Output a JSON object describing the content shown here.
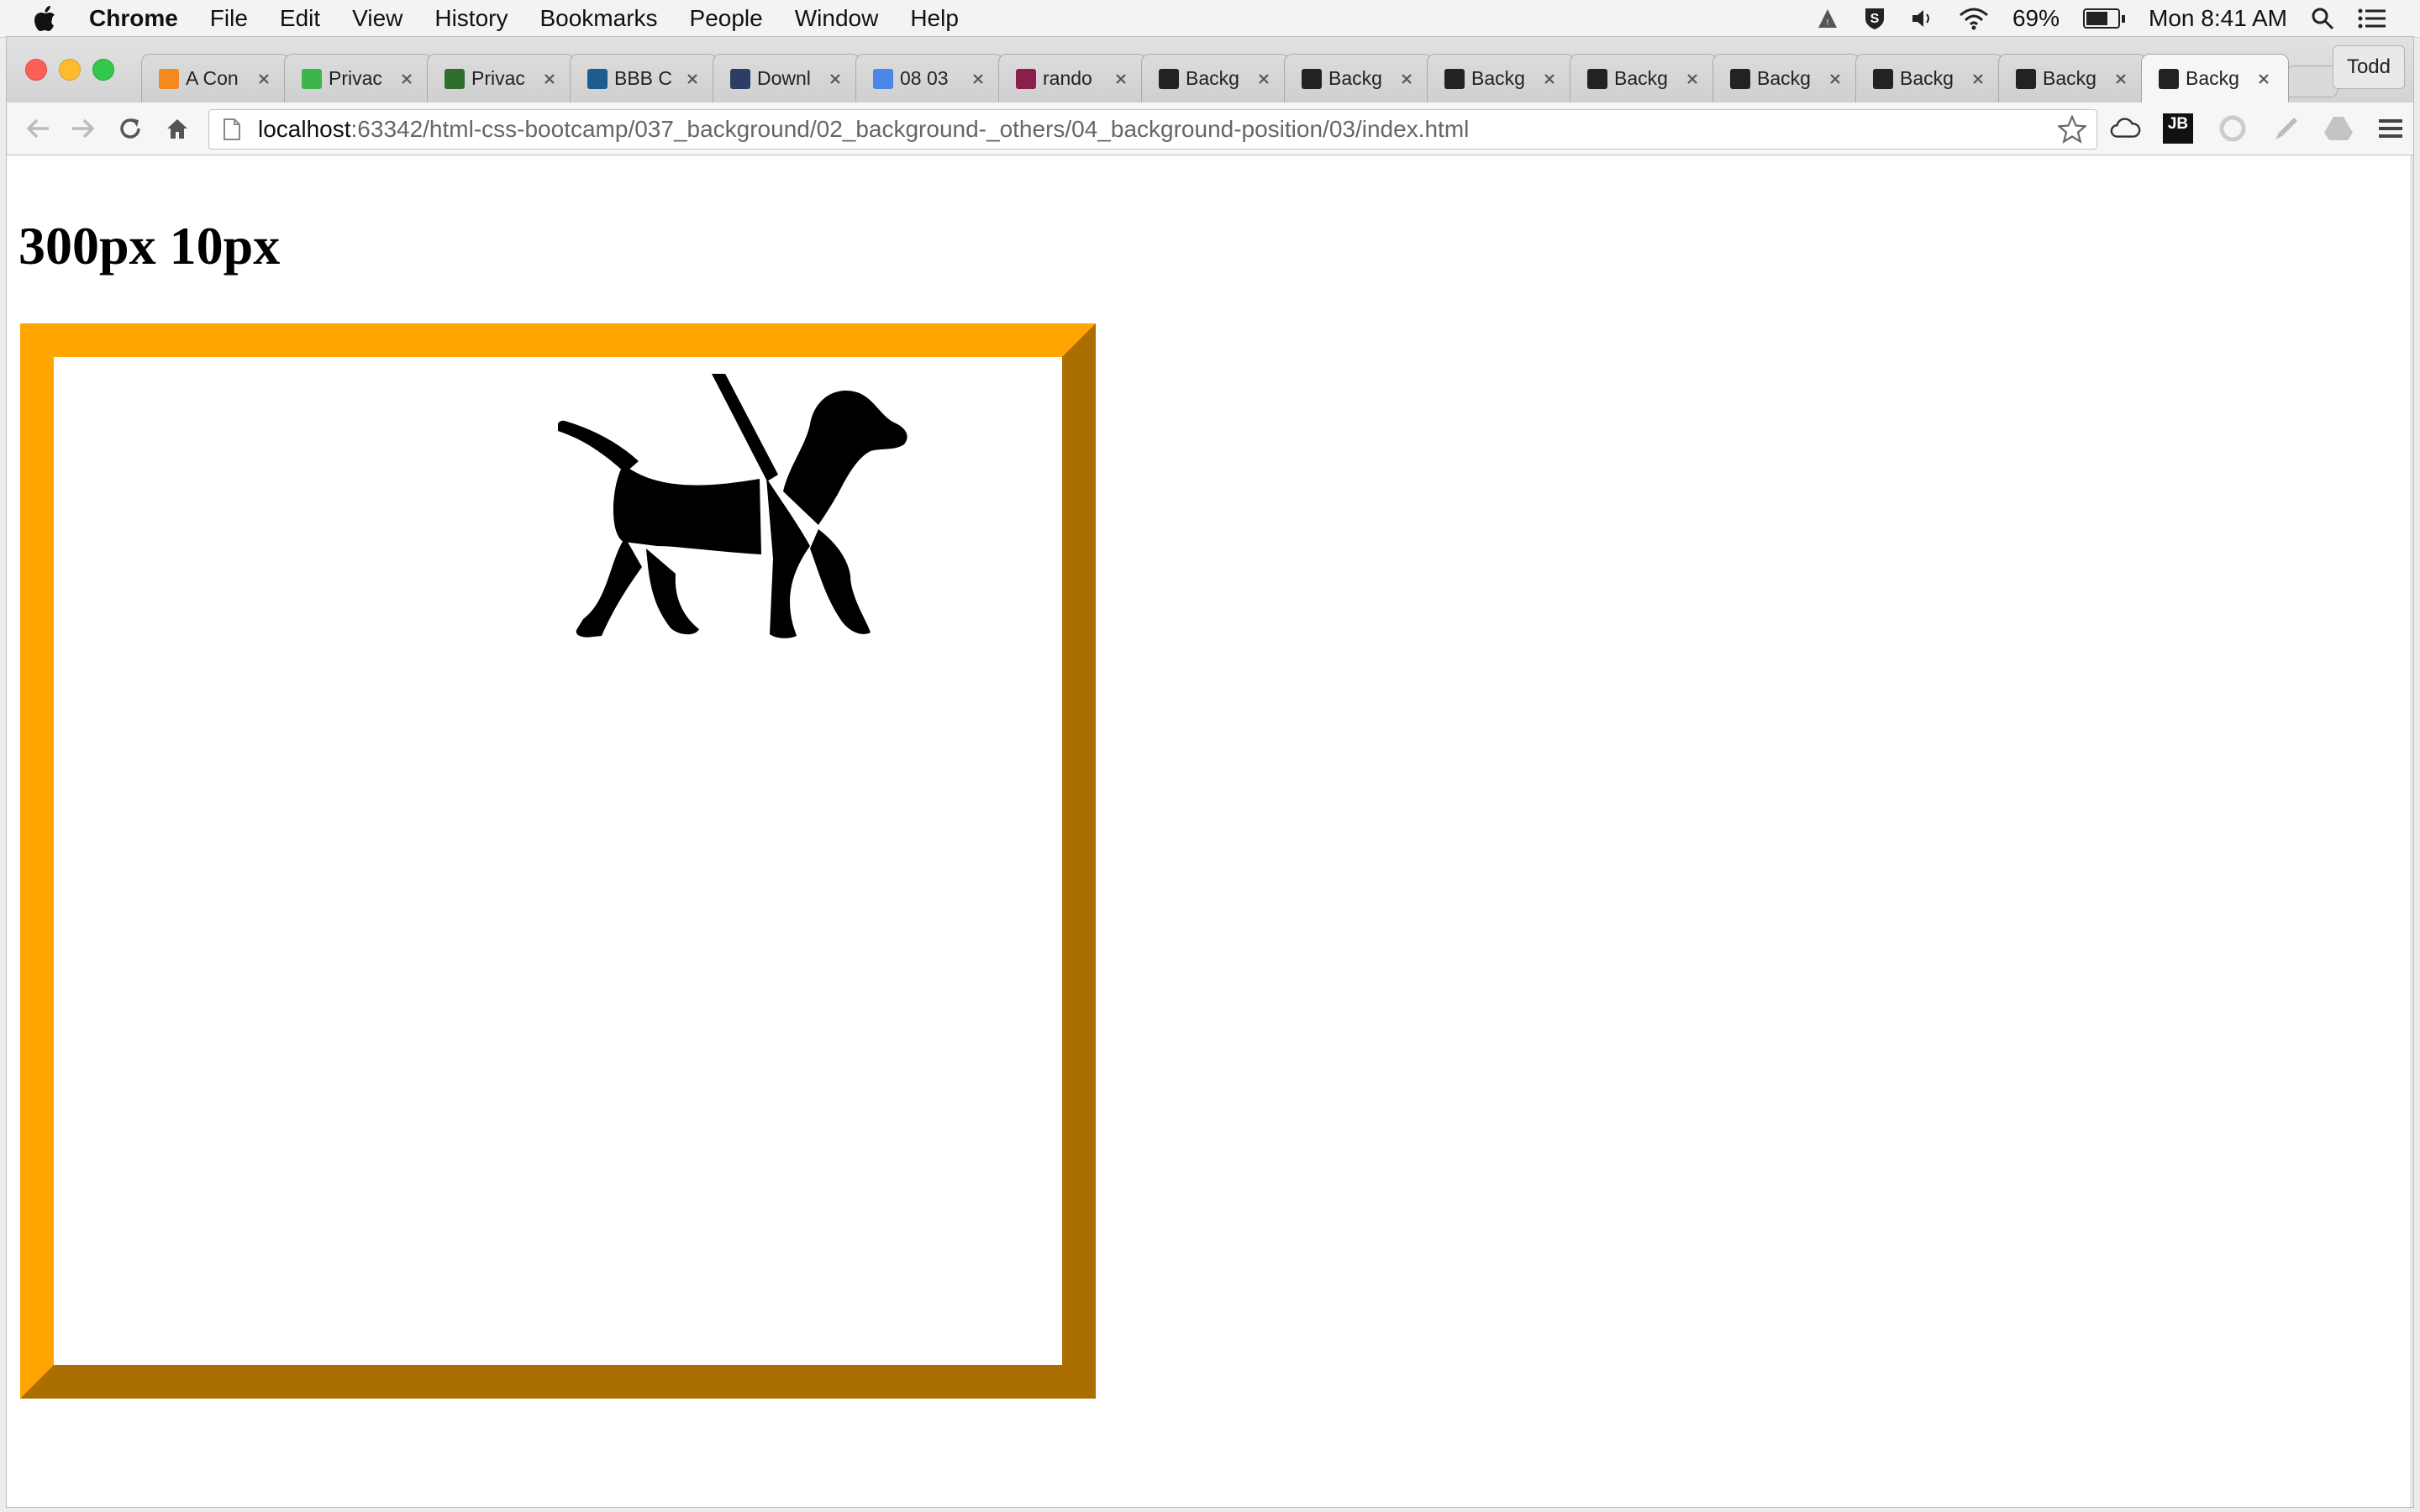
{
  "menubar": {
    "app_name": "Chrome",
    "menus": [
      "File",
      "Edit",
      "View",
      "History",
      "Bookmarks",
      "People",
      "Window",
      "Help"
    ],
    "battery_text": "69%",
    "battery_level": 0.69,
    "clock": "Mon 8:41 AM"
  },
  "browser": {
    "profile_name": "Todd",
    "tabs": [
      {
        "title": "A Con",
        "icon": "asterisk-icon",
        "color": "#f48a1f"
      },
      {
        "title": "Privac",
        "icon": "u-icon",
        "color": "#3cb54a"
      },
      {
        "title": "Privac",
        "icon": "c-icon",
        "color": "#2f6e2f"
      },
      {
        "title": "BBB C",
        "icon": "bbb-torch-icon",
        "color": "#1d5c8c"
      },
      {
        "title": "Downl",
        "icon": "lock-circle-icon",
        "color": "#2c3e63"
      },
      {
        "title": "08 03",
        "icon": "docs-icon",
        "color": "#4a86e8"
      },
      {
        "title": "rando",
        "icon": "slack-icon",
        "color": "#8a1f4c"
      },
      {
        "title": "Backg",
        "icon": "webstorm-icon",
        "color": "#222222"
      },
      {
        "title": "Backg",
        "icon": "webstorm-icon",
        "color": "#222222"
      },
      {
        "title": "Backg",
        "icon": "webstorm-icon",
        "color": "#222222"
      },
      {
        "title": "Backg",
        "icon": "webstorm-icon",
        "color": "#222222"
      },
      {
        "title": "Backg",
        "icon": "webstorm-icon",
        "color": "#222222"
      },
      {
        "title": "Backg",
        "icon": "webstorm-icon",
        "color": "#222222"
      },
      {
        "title": "Backg",
        "icon": "webstorm-icon",
        "color": "#222222"
      },
      {
        "title": "Backg",
        "icon": "webstorm-icon",
        "color": "#222222",
        "active": true
      }
    ],
    "url_host": "localhost",
    "url_rest": ":63342/html-css-bootcamp/037_background/02_background-_others/04_background-position/03/index.html",
    "ext_jb_label": "JB"
  },
  "page": {
    "heading": "300px 10px",
    "box_border_color": "#ffa500",
    "background_icon": "guide-dog-icon"
  }
}
